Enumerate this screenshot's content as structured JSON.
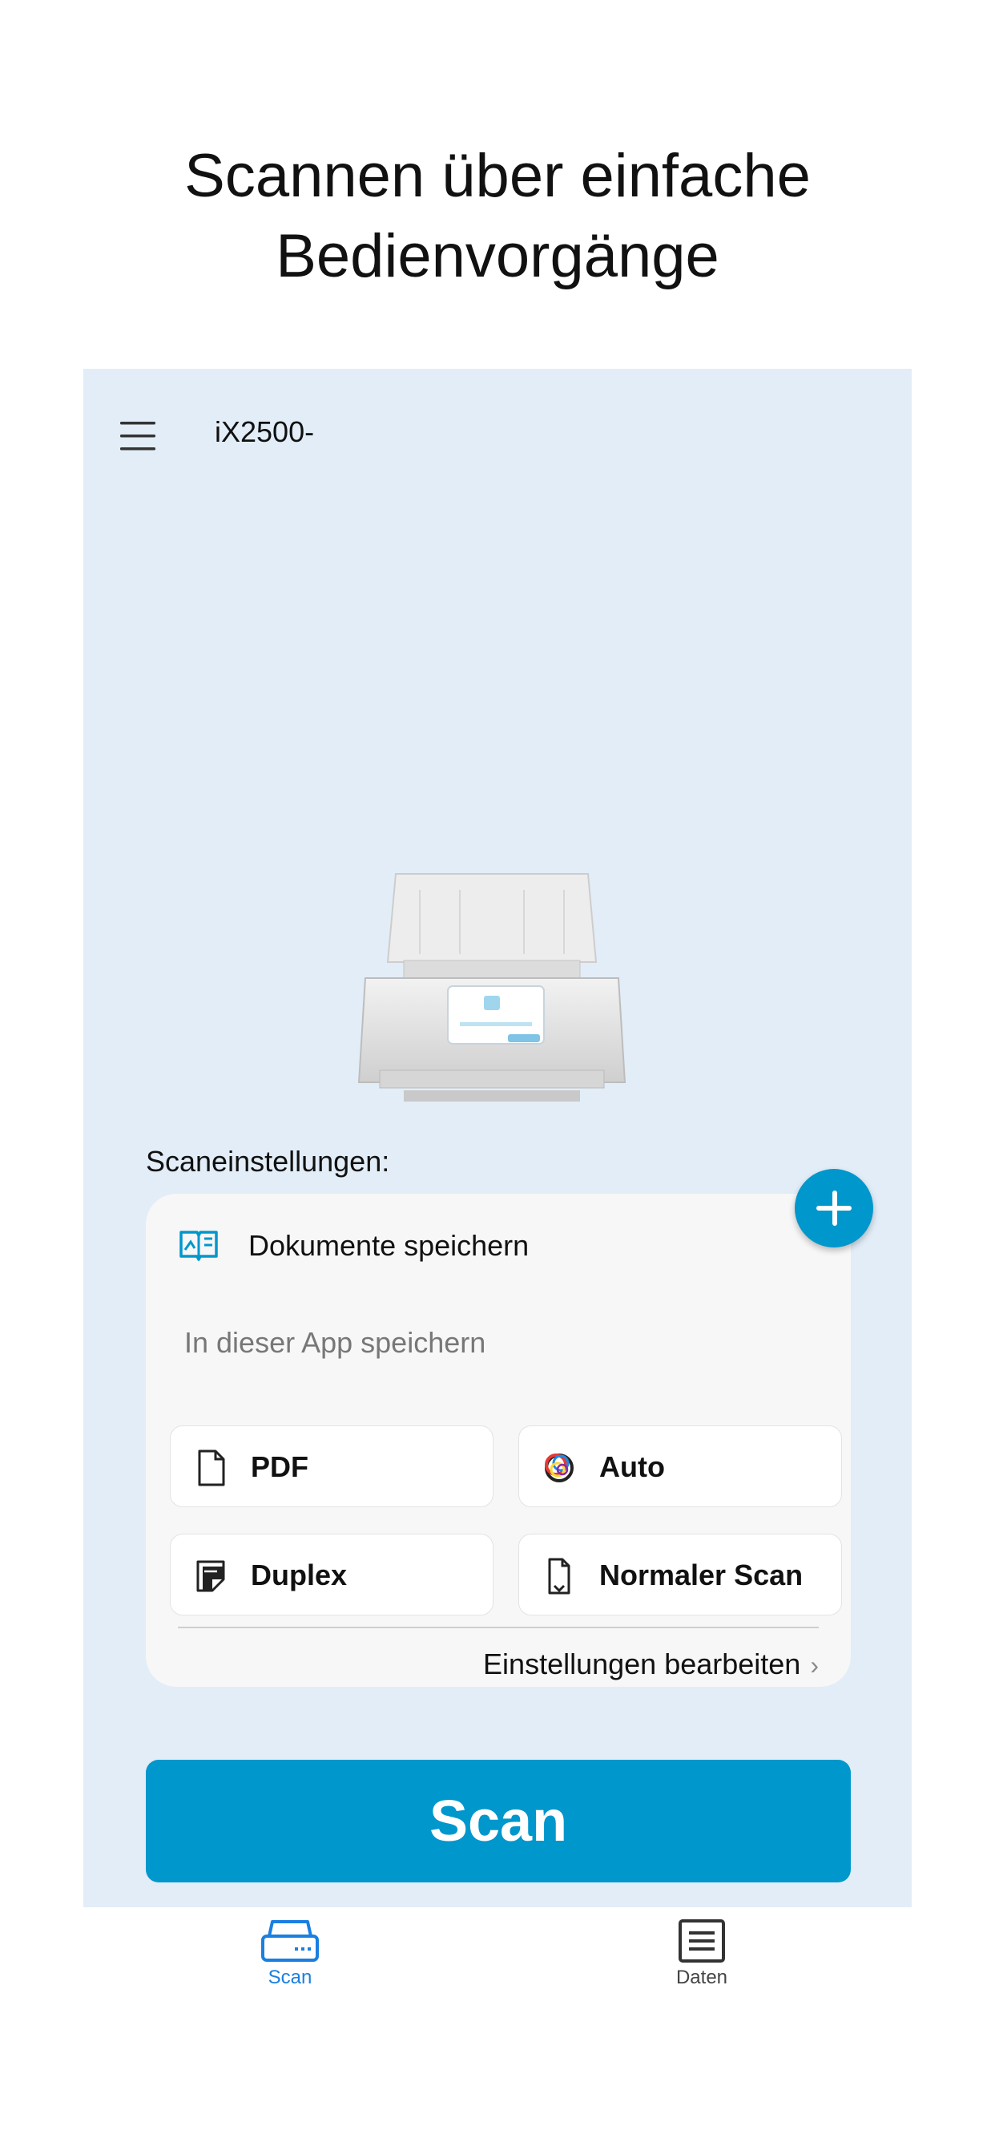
{
  "headline": [
    "Scannen über einfache",
    "Bedienvorgänge"
  ],
  "app_bar": {
    "device_name": "iX2500-"
  },
  "scan_settings": {
    "section_label": "Scaneinstellungen:",
    "profile_name": "Dokumente speichern",
    "save_location": "In dieser App speichern",
    "options": [
      {
        "label": "PDF",
        "icon": "document-icon"
      },
      {
        "label": "Auto",
        "icon": "color-mode-icon"
      },
      {
        "label": "Duplex",
        "icon": "duplex-icon"
      },
      {
        "label": "Normaler Scan",
        "icon": "normal-scan-icon"
      }
    ],
    "edit_link": "Einstellungen bearbeiten"
  },
  "scan_button": "Scan",
  "tabs": [
    {
      "label": "Scan",
      "icon": "scanner-icon",
      "active": true
    },
    {
      "label": "Daten",
      "icon": "list-icon",
      "active": false
    }
  ],
  "colors": {
    "accent": "#0097cc",
    "tab_active": "#1a7fe0",
    "panel_bg": "#e2edf7"
  }
}
